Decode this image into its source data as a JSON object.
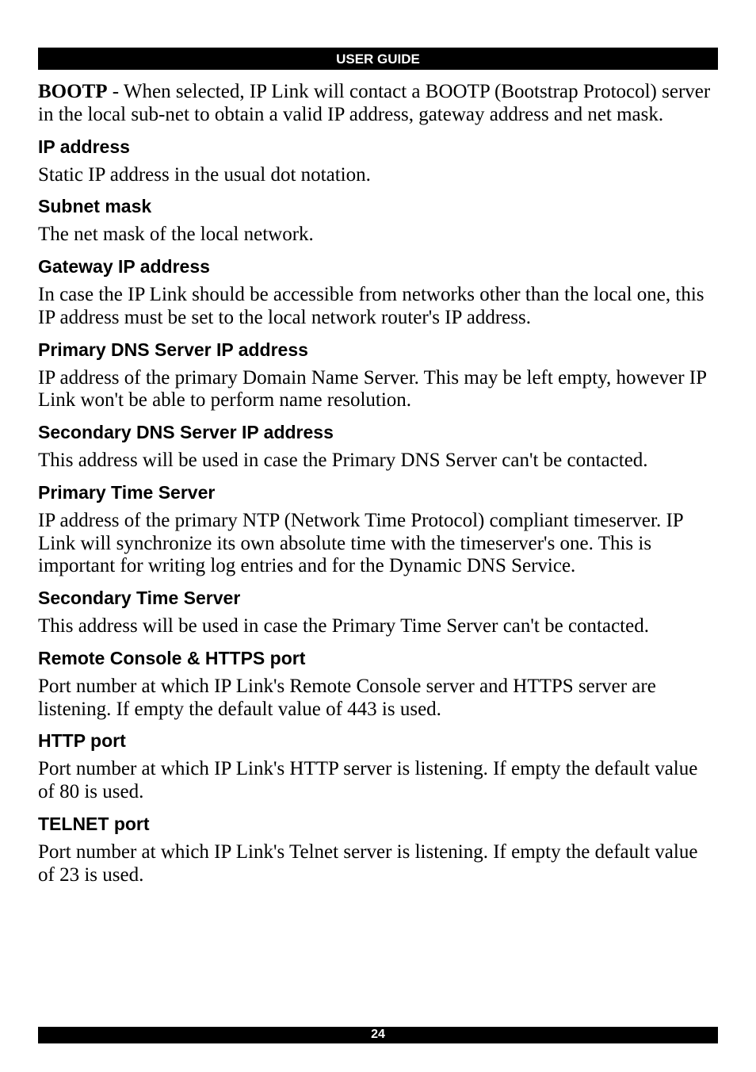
{
  "header": {
    "title": "USER GUIDE"
  },
  "footer": {
    "page_number": "24"
  },
  "intro": {
    "lead_bold": "BOOTP",
    "lead_rest": " - When selected, IP Link will contact a BOOTP (Bootstrap Protocol) server in the local sub-net to obtain a valid IP address, gateway address and net mask."
  },
  "sections": [
    {
      "heading": "IP address",
      "body": "Static IP address in the usual dot notation."
    },
    {
      "heading": "Subnet mask",
      "body": "The net mask of the local network."
    },
    {
      "heading": "Gateway IP address",
      "body": "In case the IP Link should be accessible from networks other than the local one, this IP address must be set to the local network router's IP address."
    },
    {
      "heading": "Primary DNS Server IP address",
      "body": "IP address of the primary Domain Name Server. This may be left empty, however IP Link won't be able to perform name resolution."
    },
    {
      "heading": "Secondary DNS Server IP address",
      "body": "This address will be used in case the Primary DNS Server can't be contacted."
    },
    {
      "heading": "Primary Time Server",
      "body": "IP address of the primary NTP (Network Time Protocol) compliant timeserver. IP Link will synchronize its own absolute time with the timeserver's one. This is important for writing log entries and for the Dynamic DNS Service."
    },
    {
      "heading": "Secondary Time Server",
      "body": "This address will be used in case the Primary Time Server can't be contacted."
    },
    {
      "heading": "Remote Console & HTTPS port",
      "body": "Port number at which IP Link's Remote Console server and HTTPS server are listening. If empty the default value of 443 is used."
    },
    {
      "heading": "HTTP port",
      "body": "Port number at which IP Link's HTTP server is listening. If empty the default value of 80 is used."
    },
    {
      "heading": "TELNET port",
      "body": "Port number at which IP Link's Telnet server is listening. If empty the default value of 23 is used."
    }
  ]
}
